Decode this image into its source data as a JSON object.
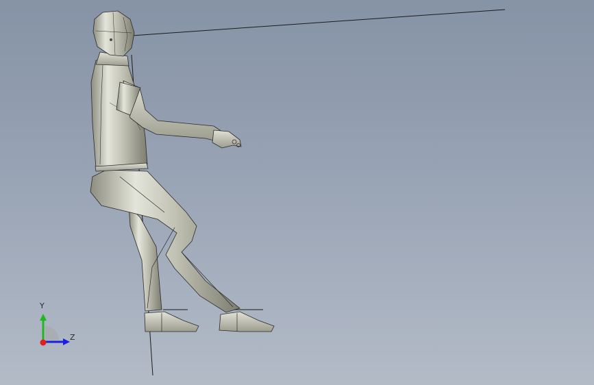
{
  "viewport": {
    "background_top": "#8693a6",
    "background_bottom": "#b3bbc7"
  },
  "model": {
    "icon": "human-mannequin-sitting"
  },
  "triad": {
    "y_label": "Y",
    "z_label": "Z",
    "y_color": "#1fb81f",
    "z_color": "#1e1ee0",
    "x_color": "#e01e1e"
  }
}
